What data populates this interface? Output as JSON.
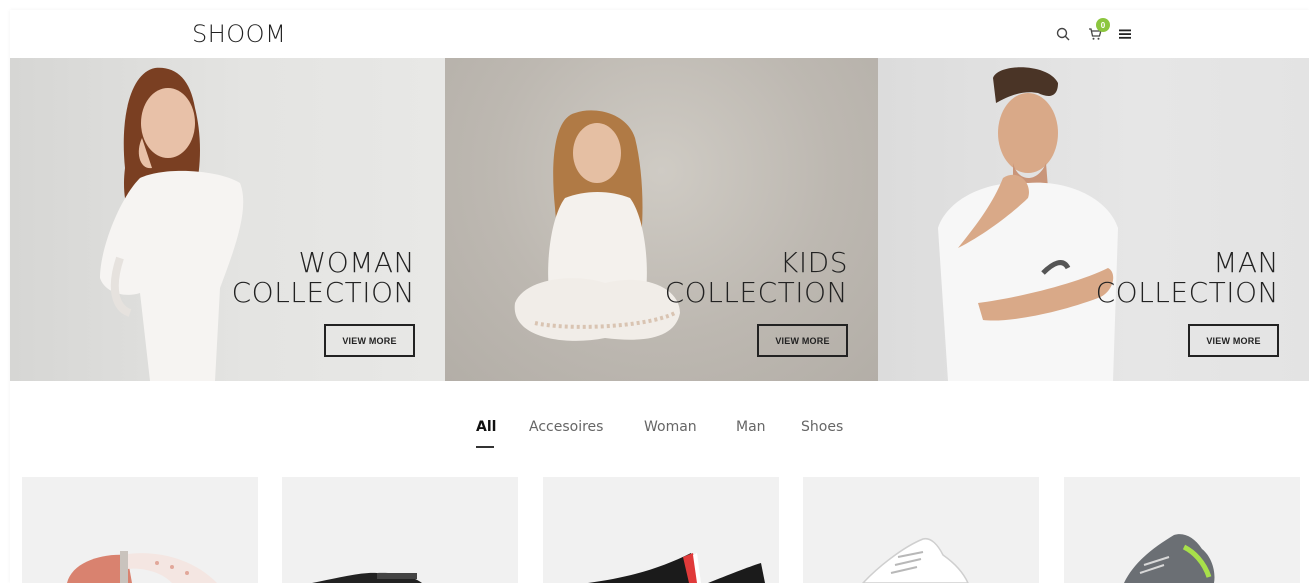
{
  "header": {
    "logo": "SHOOM",
    "cart_count": "0",
    "icons": [
      "search-icon",
      "cart-icon",
      "menu-icon"
    ]
  },
  "banners": [
    {
      "line1": "WOMAN",
      "line2": "COLLECTION",
      "button": "VIEW MORE"
    },
    {
      "line1": "KIDS",
      "line2": "COLLECTION",
      "button": "VIEW MORE"
    },
    {
      "line1": "MAN",
      "line2": "COLLECTION",
      "button": "VIEW MORE"
    }
  ],
  "tabs": [
    {
      "label": "All",
      "active": true
    },
    {
      "label": "Accesoires",
      "active": false
    },
    {
      "label": "Woman",
      "active": false
    },
    {
      "label": "Man",
      "active": false
    },
    {
      "label": "Shoes",
      "active": false
    }
  ],
  "products": [
    {
      "kind": "belt-image"
    },
    {
      "kind": "black-shoe-image"
    },
    {
      "kind": "striped-shoe-image"
    },
    {
      "kind": "white-sneaker-image"
    },
    {
      "kind": "grey-sneaker-image"
    }
  ],
  "colors": {
    "accent": "#8cc63f",
    "text": "#222222",
    "product_bg": "#f1f1f1"
  }
}
